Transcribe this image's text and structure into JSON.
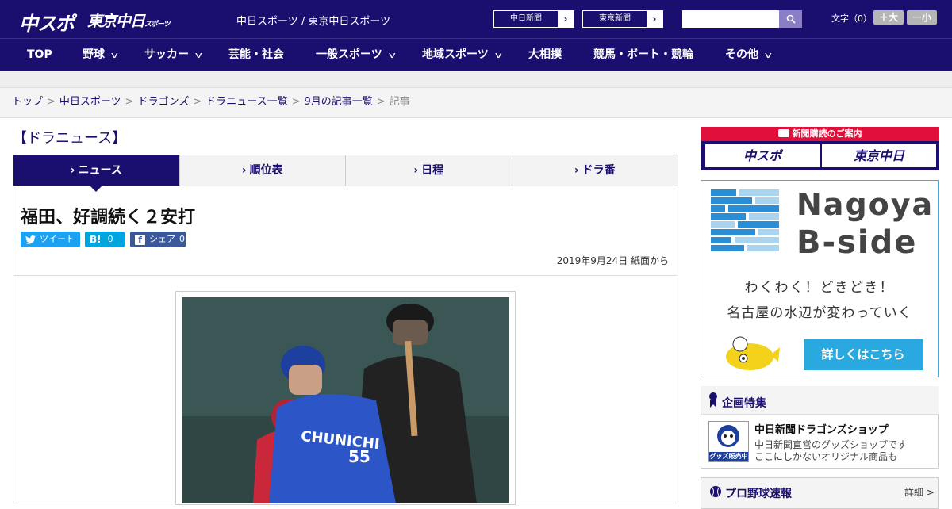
{
  "header": {
    "logo_chuspo": "中スポ",
    "logo_tokyo": "東京中日",
    "logo_tokyo_sub": "スポーツ",
    "site_title": "中日スポーツ / 東京中日スポーツ",
    "ext_links": [
      "中日新聞",
      "東京新聞"
    ],
    "search_placeholder": "",
    "font_size_label": "文字（0）",
    "font_bigger": "＋大",
    "font_smaller": "－小"
  },
  "nav": [
    {
      "label": "TOP",
      "dropdown": false
    },
    {
      "label": "野球",
      "dropdown": true
    },
    {
      "label": "サッカー",
      "dropdown": true
    },
    {
      "label": "芸能・社会",
      "dropdown": false
    },
    {
      "label": "一般スポーツ",
      "dropdown": true
    },
    {
      "label": "地域スポーツ",
      "dropdown": true
    },
    {
      "label": "大相撲",
      "dropdown": false
    },
    {
      "label": "競馬・ボート・競輪",
      "dropdown": false
    },
    {
      "label": "その他",
      "dropdown": true
    }
  ],
  "breadcrumb": {
    "items": [
      "トップ",
      "中日スポーツ",
      "ドラゴンズ",
      "ドラニュース一覧",
      "9月の記事一覧"
    ],
    "current": "記事",
    "separator": ">"
  },
  "section_title": "【ドラニュース】",
  "tabs": [
    {
      "label": "ニュース",
      "active": true
    },
    {
      "label": "順位表",
      "active": false
    },
    {
      "label": "日程",
      "active": false
    },
    {
      "label": "ドラ番",
      "active": false
    }
  ],
  "article": {
    "headline": "福田、好調続く２安打",
    "share": {
      "tweet": "ツイート",
      "hatena_label": "B!",
      "hatena_count": "0",
      "facebook": "シェア",
      "facebook_count": "0"
    },
    "date": "2019年9月24日 紙面から",
    "photo_text": "CHUNICHI",
    "photo_number": "55"
  },
  "sidebar": {
    "subscribe_title": "新聞購読のご案内",
    "subscribe_cards": [
      "中スポ",
      "東京中日"
    ],
    "ad": {
      "name_line1": "Nagoya",
      "name_line2": "B-side",
      "copy_line1": "わくわく！どきどき！",
      "copy_line2": "名古屋の水辺が変わっていく",
      "cta": "詳しくはこちら"
    },
    "feature": {
      "title": "企画特集",
      "item_title": "中日新聞ドラゴンズショップ",
      "desc_line1": "中日新聞直営のグッズショップです",
      "desc_line2": "ここにしかないオリジナル商品も",
      "thumb_label": "グッズ販売中"
    },
    "live": {
      "title": "プロ野球速報",
      "more": "詳細 >"
    }
  },
  "colors": {
    "brand": "#1a0f6e",
    "accent_red": "#e0103a",
    "twitter": "#1da1f2",
    "hatena": "#00a4de",
    "facebook": "#3b5998",
    "ad_blue": "#2aa8e0"
  }
}
